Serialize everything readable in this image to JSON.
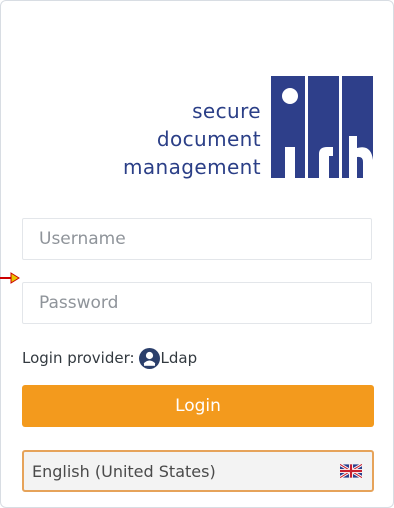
{
  "brand": {
    "line1": "secure",
    "line2": "document",
    "line3": "management",
    "logo_icon": "irb-logo"
  },
  "form": {
    "username_placeholder": "Username",
    "password_placeholder": "Password",
    "provider_label": "Login provider:",
    "provider_name": "Ldap",
    "provider_icon": "ldap-user-icon",
    "login_label": "Login"
  },
  "language": {
    "selected": "English (United States)",
    "flag_icon": "uk-flag-icon"
  },
  "colors": {
    "brand_blue": "#2b3f87",
    "login_orange": "#f39a1d",
    "lang_border": "#e6a35a"
  }
}
